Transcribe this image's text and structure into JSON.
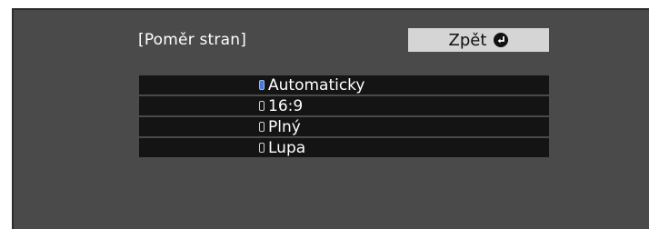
{
  "header": {
    "title": "[Poměr stran]",
    "back_label": "Zpět"
  },
  "menu": {
    "items": [
      {
        "label": "Automaticky",
        "selected": true
      },
      {
        "label": "16:9",
        "selected": false
      },
      {
        "label": "Plný",
        "selected": false
      },
      {
        "label": "Lupa",
        "selected": false
      }
    ]
  },
  "colors": {
    "panel_background": "#4a4a4a",
    "item_background": "#141414",
    "button_background": "#d5d5d5",
    "selected_radio": "#4a78d8"
  },
  "icons": {
    "back": "enter-return-icon",
    "radio_on": "radio-selected-icon",
    "radio_off": "radio-unselected-icon"
  }
}
